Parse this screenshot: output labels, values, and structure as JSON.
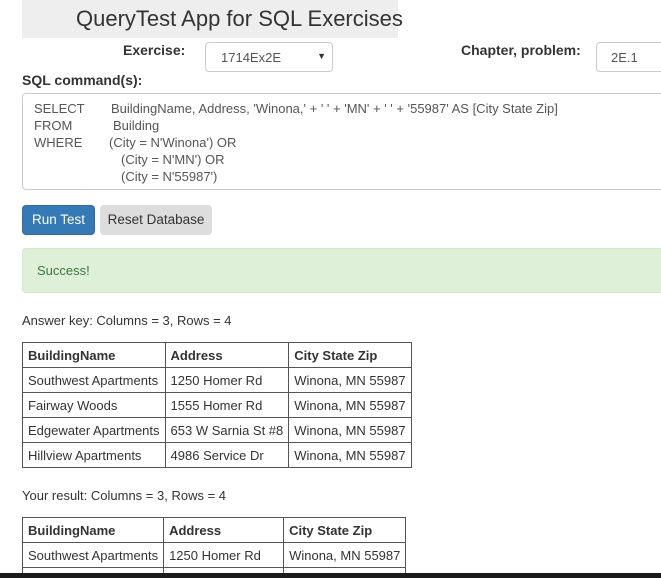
{
  "header": {
    "title": "QueryTest App for SQL Exercises"
  },
  "form": {
    "exercise_label": "Exercise:",
    "exercise_value": "1714Ex2E",
    "chapter_label": "Chapter, problem:",
    "chapter_value": "2E.1",
    "sql_label": "SQL command(s):",
    "sql_lines": [
      {
        "keyword": "SELECT",
        "text": "BuildingName, Address, 'Winona,' + ' ' + 'MN' + ' ' + '55987' AS [City State Zip]"
      },
      {
        "keyword": "FROM",
        "text": "Building"
      },
      {
        "keyword": "WHERE",
        "text": "(City = N'Winona') OR"
      },
      {
        "keyword": "",
        "text": "(City = N'MN') OR"
      },
      {
        "keyword": "",
        "text": "(City = N'55987')"
      }
    ]
  },
  "buttons": {
    "run_label": "Run Test",
    "reset_label": "Reset Database"
  },
  "alert": {
    "message": "Success!"
  },
  "answer_key": {
    "caption": "Answer key: Columns = 3, Rows = 4",
    "columns": [
      "BuildingName",
      "Address",
      "City State Zip"
    ],
    "rows": [
      [
        "Southwest Apartments",
        "1250 Homer Rd",
        "Winona, MN 55987"
      ],
      [
        "Fairway Woods",
        "1555 Homer Rd",
        "Winona, MN 55987"
      ],
      [
        "Edgewater Apartments",
        "653 W Sarnia St #8",
        "Winona, MN 55987"
      ],
      [
        "Hillview Apartments",
        "4986 Service Dr",
        "Winona, MN 55987"
      ]
    ]
  },
  "your_result": {
    "caption": "Your result: Columns = 3, Rows = 4",
    "columns": [
      "BuildingName",
      "Address",
      "City State Zip"
    ],
    "rows": [
      [
        "Southwest Apartments",
        "1250 Homer Rd",
        "Winona, MN 55987"
      ]
    ]
  },
  "colors": {
    "primary_button": "#337ab7",
    "success_bg": "#dff0d8",
    "success_text": "#3c763d"
  }
}
